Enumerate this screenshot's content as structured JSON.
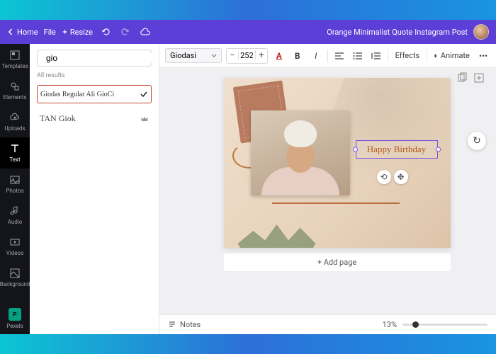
{
  "topbar": {
    "home": "Home",
    "file": "File",
    "resize": "Resize",
    "title": "Orange Minimalist Quote Instagram Post"
  },
  "rail": {
    "templates": "Templates",
    "elements": "Elements",
    "uploads": "Uploads",
    "text": "Text",
    "photos": "Photos",
    "audio": "Audio",
    "videos": "Videos",
    "background": "Background",
    "pexels": "Pexels"
  },
  "panel": {
    "search_value": "gio",
    "all_results": "All results",
    "fonts": [
      {
        "name": "Giodas Regular  Ali GioCi",
        "style": "script",
        "mark": "check"
      },
      {
        "name": "TAN Giok",
        "style": "serif",
        "mark": "crown"
      }
    ]
  },
  "toolbar": {
    "font_name": "Giodasi",
    "font_size": "252",
    "effects": "Effects",
    "animate": "Animate"
  },
  "canvas": {
    "text_content": "Happy Birthday",
    "add_page": "+ Add page"
  },
  "bottom": {
    "notes": "Notes",
    "zoom": "13%"
  }
}
